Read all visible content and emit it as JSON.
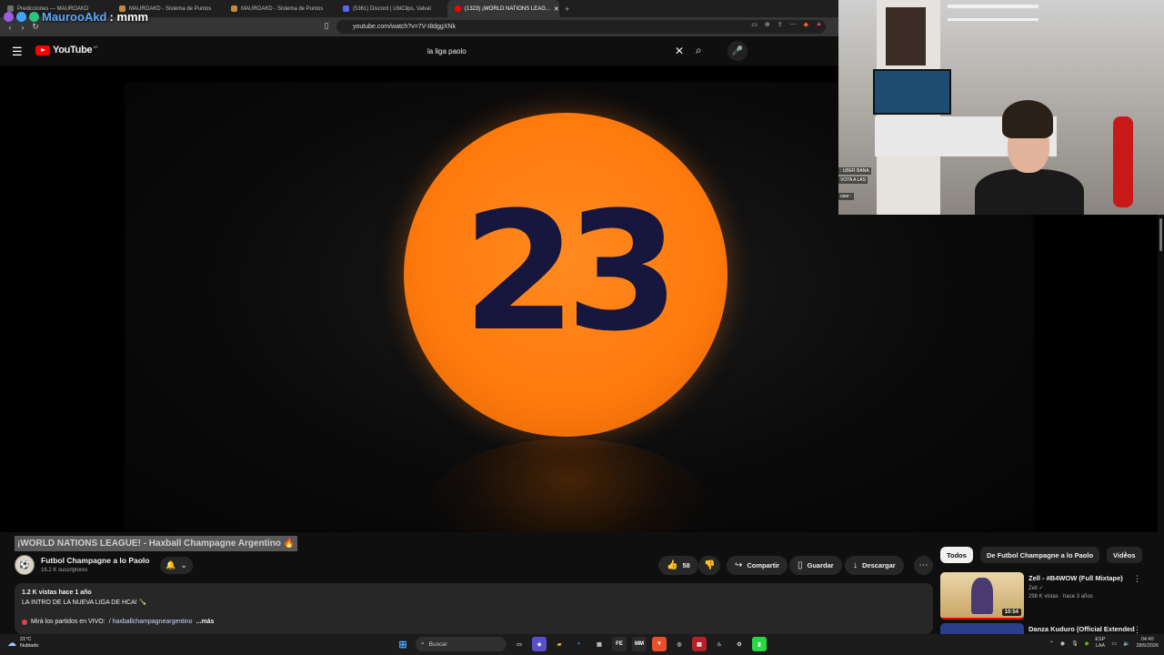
{
  "browser": {
    "tabs": [
      {
        "label": "Predicciones — MAUROAKD",
        "color": "#6e6e6e",
        "active": false
      },
      {
        "label": "MAUROAKD - Sistema de Puntos",
        "color": "#c08a3a",
        "active": false
      },
      {
        "label": "MAUROAKD - Sistema de Puntos",
        "color": "#c08a3a",
        "active": false
      },
      {
        "label": "(5361) Discord | UbiClips, Valval",
        "color": "#5865f2",
        "active": false
      },
      {
        "label": "(1323) ¡WORLD NATIONS LEAG...",
        "color": "#ff0000",
        "active": true
      }
    ],
    "new_tab": "+",
    "url": "youtube.com/watch?v=7V-I8dggXNk"
  },
  "chat_overlay": {
    "user": "MaurooAkd",
    "message": ": mmm"
  },
  "youtube": {
    "logo": "YouTube",
    "country": "AR",
    "search_value": "la liga paolo",
    "search_clear": "✕",
    "search_icon": "search-icon",
    "mic_icon": "mic-icon"
  },
  "player": {
    "ball_text": "23",
    "ball_color": "#ff7a0d",
    "text_color": "#17163f"
  },
  "video": {
    "title": "¡WORLD NATIONS LEAGUE! - Haxball Champagne Argentino 🔥",
    "channel": "Futbol Champagne a lo Paolo",
    "subscribers": "16.2 K suscriptores",
    "likes": "58",
    "share": "Compartir",
    "save": "Guardar",
    "download": "Descargar",
    "description": {
      "meta": "1.2 K vistas  hace 1 año",
      "line1": "LA INTRO DE LA NUEVA LIGA DE HCA! 🍾",
      "live_prefix": "Mirá los partidos en VIVO:",
      "live_link": "/ haxballchampagneargentino",
      "more": "...más"
    }
  },
  "sidebar": {
    "chips": [
      "Todos",
      "De Futbol Champagne a lo Paolo",
      "Videos"
    ],
    "recommendations": [
      {
        "title": "Zell - #B4WOW (Full Mixtape)",
        "channel": "Zell ✓",
        "meta": "298 K vistas · hace 3 años",
        "duration": "10:54"
      },
      {
        "title": "Danza Kuduro (Official Extended",
        "channel": "",
        "meta": "",
        "duration": ""
      }
    ]
  },
  "webcam": {
    "chat_lines": [
      ": UBER BANA",
      "VOTA A LAS",
      "oser :"
    ]
  },
  "taskbar": {
    "temp": "21°C",
    "weather": "Nublado",
    "search": "Buscar",
    "lang1": "ESP",
    "lang2": "LAA",
    "time": "04:40",
    "date": "28/5/2026"
  }
}
